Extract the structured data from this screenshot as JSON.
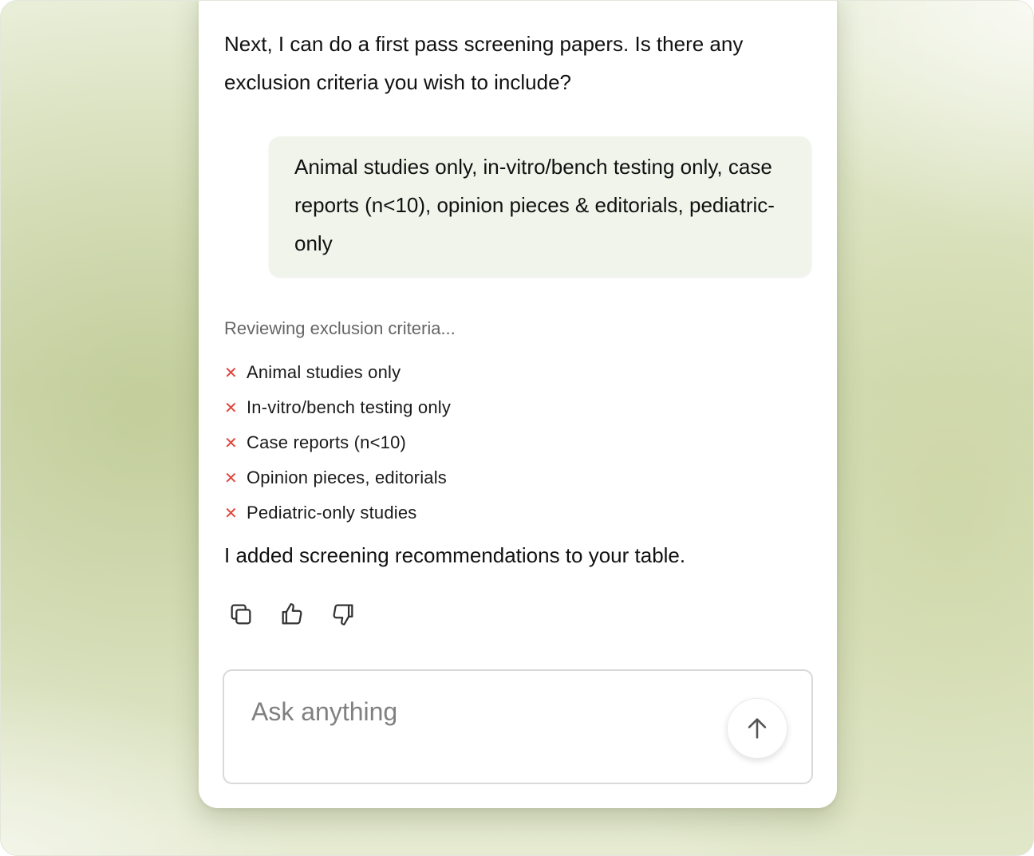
{
  "assistant": {
    "intro": "Next, I can do a first pass screening papers. Is there any exclusion criteria you wish to include?",
    "status": "Reviewing exclusion criteria...",
    "criteria": [
      "Animal studies only",
      "In-vitro/bench testing only",
      "Case reports (n<10)",
      "Opinion pieces, editorials",
      "Pediatric-only studies"
    ],
    "result": "I added screening recommendations to your table."
  },
  "user": {
    "message": "Animal studies only, in-vitro/bench testing only, case reports (n<10), opinion pieces & editorials, pediatric-only"
  },
  "actions": {
    "copy_icon": "copy-icon",
    "like_icon": "thumbs-up-icon",
    "dislike_icon": "thumbs-down-icon"
  },
  "composer": {
    "placeholder": "Ask anything",
    "send_icon": "arrow-up-icon"
  },
  "colors": {
    "user_bubble_bg": "#f1f4eb",
    "exclude_mark": "#e0443c",
    "background_accent": "#d8e0bb"
  }
}
